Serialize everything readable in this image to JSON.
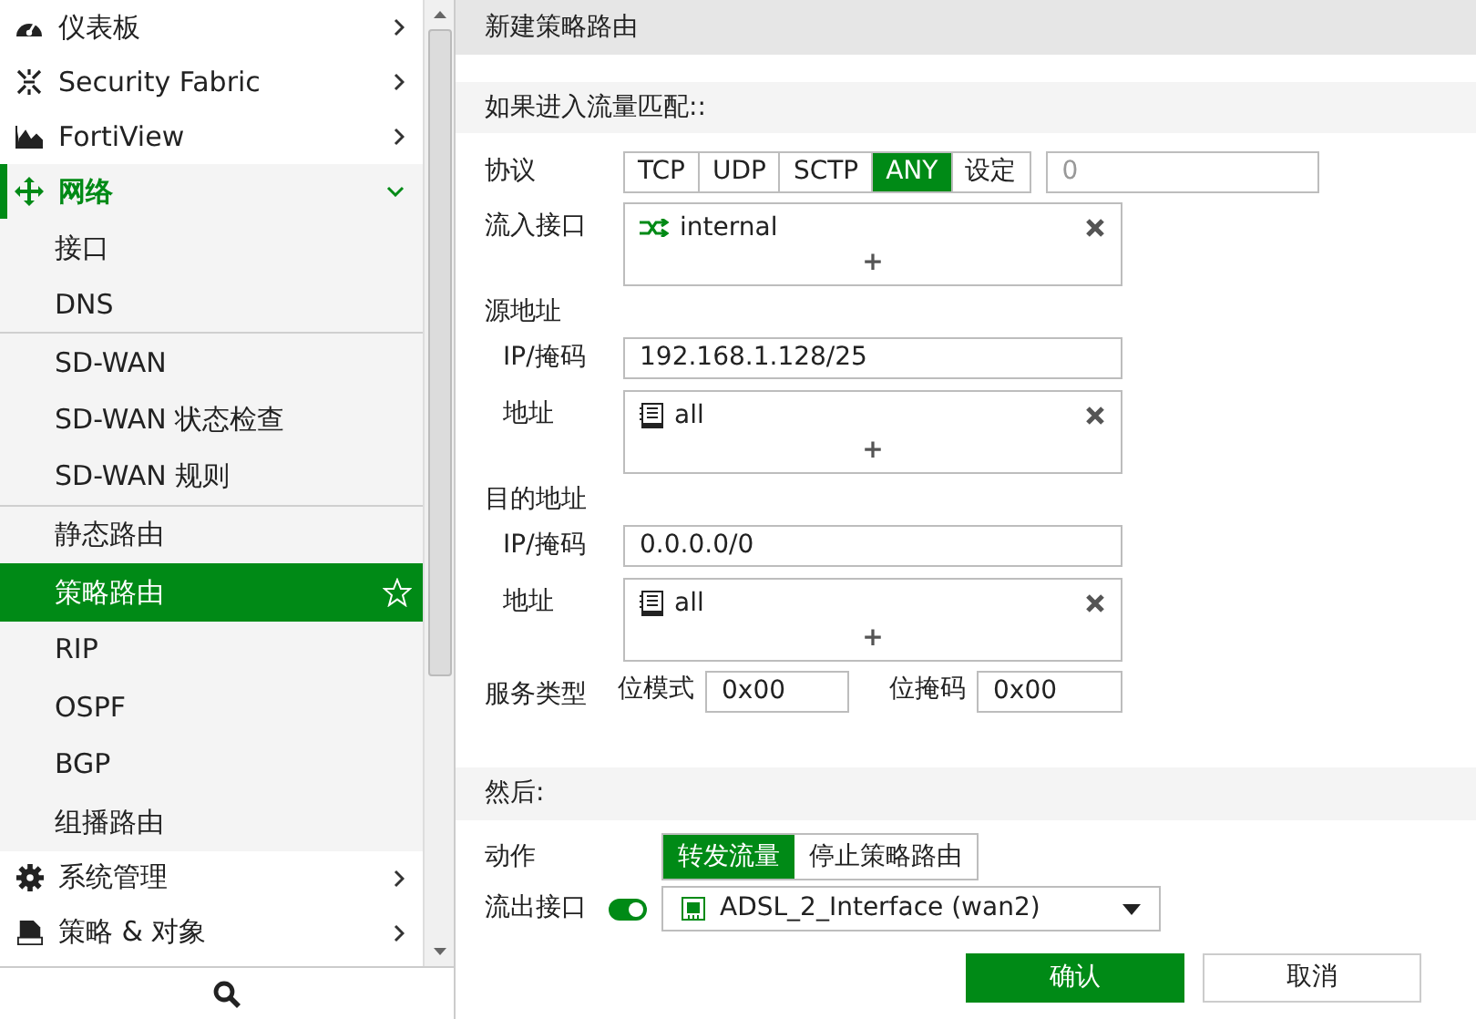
{
  "sidebar": {
    "items": [
      {
        "label": "仪表板",
        "kind": "menu",
        "expanded": false
      },
      {
        "label": "Security Fabric",
        "kind": "menu",
        "expanded": false
      },
      {
        "label": "FortiView",
        "kind": "menu",
        "expanded": false
      },
      {
        "label": "网络",
        "kind": "menu",
        "expanded": true,
        "children": [
          {
            "label": "接口",
            "selected": false,
            "divider_after": false
          },
          {
            "label": "DNS",
            "selected": false,
            "divider_after": true
          },
          {
            "label": "SD-WAN",
            "selected": false,
            "divider_after": false
          },
          {
            "label": "SD-WAN 状态检查",
            "selected": false,
            "divider_after": false
          },
          {
            "label": "SD-WAN 规则",
            "selected": false,
            "divider_after": true
          },
          {
            "label": "静态路由",
            "selected": false,
            "divider_after": false
          },
          {
            "label": "策略路由",
            "selected": true,
            "divider_after": false
          },
          {
            "label": "RIP",
            "selected": false,
            "divider_after": false
          },
          {
            "label": "OSPF",
            "selected": false,
            "divider_after": false
          },
          {
            "label": "BGP",
            "selected": false,
            "divider_after": false
          },
          {
            "label": "组播路由",
            "selected": false,
            "divider_after": false
          }
        ]
      },
      {
        "label": "系统管理",
        "kind": "menu",
        "expanded": false
      },
      {
        "label": "策略 & 对象",
        "kind": "menu",
        "expanded": false
      }
    ]
  },
  "title": "新建策略路由",
  "match": {
    "heading": "如果进入流量匹配::",
    "protocol": {
      "label": "协议",
      "options": [
        {
          "label": "TCP",
          "selected": false
        },
        {
          "label": "UDP",
          "selected": false
        },
        {
          "label": "SCTP",
          "selected": false
        },
        {
          "label": "ANY",
          "selected": true
        },
        {
          "label": "设定",
          "selected": false
        }
      ],
      "value": "0",
      "disabled": true
    },
    "incoming": {
      "label": "流入接口",
      "entries": [
        {
          "label": "internal",
          "kind": "interface"
        }
      ],
      "add": "+"
    },
    "source": {
      "heading": "源地址",
      "ip_label": "IP/掩码",
      "ip": "192.168.1.128/25",
      "address_label": "地址",
      "entries": [
        {
          "label": "all",
          "kind": "address"
        }
      ],
      "add": "+"
    },
    "destination": {
      "heading": "目的地址",
      "ip_label": "IP/掩码",
      "ip": "0.0.0.0/0",
      "address_label": "地址",
      "entries": [
        {
          "label": "all",
          "kind": "address"
        }
      ],
      "add": "+"
    },
    "tos": {
      "label": "服务类型",
      "pattern_label": "位模式",
      "pattern": "0x00",
      "mask_label": "位掩码",
      "mask": "0x00"
    }
  },
  "then": {
    "heading": "然后:",
    "action": {
      "label": "动作",
      "options": [
        {
          "label": "转发流量",
          "selected": true
        },
        {
          "label": "停止策略路由",
          "selected": false
        }
      ]
    },
    "outgoing": {
      "label": "流出接口",
      "on": true,
      "value": "ADSL_2_Interface (wan2)"
    }
  },
  "buttons": [
    {
      "label": "确认",
      "primary": true
    },
    {
      "label": "取消",
      "primary": false
    }
  ]
}
